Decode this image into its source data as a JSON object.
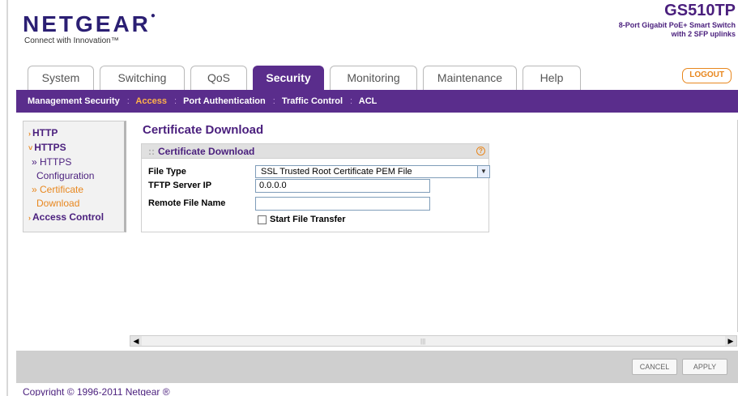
{
  "header": {
    "logo": "NETGEAR",
    "tagline": "Connect with Innovation™",
    "model": "GS510TP",
    "model_desc_line1": "8-Port Gigabit PoE+ Smart Switch",
    "model_desc_line2": "with 2 SFP uplinks",
    "logout": "LOGOUT"
  },
  "tabs": [
    "System",
    "Switching",
    "QoS",
    "Security",
    "Monitoring",
    "Maintenance",
    "Help"
  ],
  "subnav": [
    "Management Security",
    "Access",
    "Port Authentication",
    "Traffic Control",
    "ACL"
  ],
  "leftnav": {
    "http": "HTTP",
    "https": "HTTPS",
    "https_config_1": "» HTTPS",
    "https_config_2": "Configuration",
    "cert_dl_1": "» Certificate",
    "cert_dl_2": "Download",
    "access_control": "Access Control"
  },
  "page": {
    "title": "Certificate Download",
    "panel_title": "Certificate Download",
    "file_type_label": "File Type",
    "file_type_value": "SSL Trusted Root Certificate PEM File",
    "tftp_label": "TFTP Server IP",
    "tftp_value": "0.0.0.0",
    "remote_label": "Remote File Name",
    "remote_value": "",
    "start_label": "Start File Transfer"
  },
  "footer": {
    "cancel": "CANCEL",
    "apply": "APPLY",
    "copyright": "Copyright © 1996-2011 Netgear ®"
  }
}
